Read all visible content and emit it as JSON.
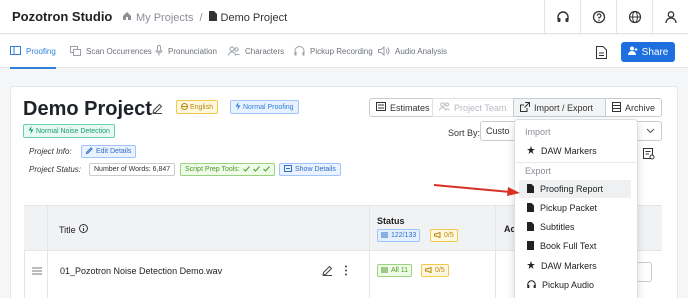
{
  "app": {
    "brand": "Pozotron Studio"
  },
  "breadcrumb": {
    "home": "My Projects",
    "separator": "/",
    "current": "Demo Project"
  },
  "nav_tabs": [
    {
      "label": "Proofing",
      "icon": "columns-icon",
      "active": true
    },
    {
      "label": "Scan Occurrences",
      "icon": "scan-icon",
      "active": false
    },
    {
      "label": "Pronunciation",
      "icon": "microphone-icon",
      "active": false
    },
    {
      "label": "Characters",
      "icon": "characters-icon",
      "active": false
    },
    {
      "label": "Pickup Recording",
      "icon": "headphones-icon",
      "active": false
    },
    {
      "label": "Audio Analysis",
      "icon": "speaker-icon",
      "active": false
    }
  ],
  "share_label": "Share",
  "project": {
    "title": "Demo Project",
    "language_chip": "English",
    "proofing_chip": "Normal Proofing",
    "noise_chip": "Normal Noise Detection",
    "info_label": "Project Info:",
    "edit_details": "Edit Details",
    "status_label": "Project Status:",
    "word_count": "Number of Words: 6,847",
    "script_prep": "Script Prep Tools:",
    "show_details": "Show Details"
  },
  "actions": {
    "estimates": "Estimates",
    "project_team": "Project Team",
    "import_export": "Import / Export",
    "archive": "Archive"
  },
  "sort": {
    "label": "Sort By:",
    "value": "Custo"
  },
  "table": {
    "title_header": "Title",
    "status_header": "Status",
    "actions_header": "Ac",
    "header_status_blue": "122/133",
    "header_status_yellow": "0/5",
    "row": {
      "name": "01_Pozotron Noise Detection Demo.wav",
      "status_green": "All 11",
      "status_yellow": "0/5"
    }
  },
  "dropdown": {
    "import_heading": "Import",
    "import_items": [
      {
        "label": "DAW Markers",
        "icon": "star-icon"
      }
    ],
    "export_heading": "Export",
    "export_items": [
      {
        "label": "Proofing Report",
        "icon": "file-icon"
      },
      {
        "label": "Pickup Packet",
        "icon": "file-icon"
      },
      {
        "label": "Subtitles",
        "icon": "file-icon"
      },
      {
        "label": "Book Full Text",
        "icon": "book-icon"
      },
      {
        "label": "DAW Markers",
        "icon": "star-icon"
      },
      {
        "label": "Pickup Audio",
        "icon": "headphones-icon"
      }
    ]
  },
  "colors": {
    "accent": "#1d6fe0",
    "arrow": "#d93025"
  }
}
